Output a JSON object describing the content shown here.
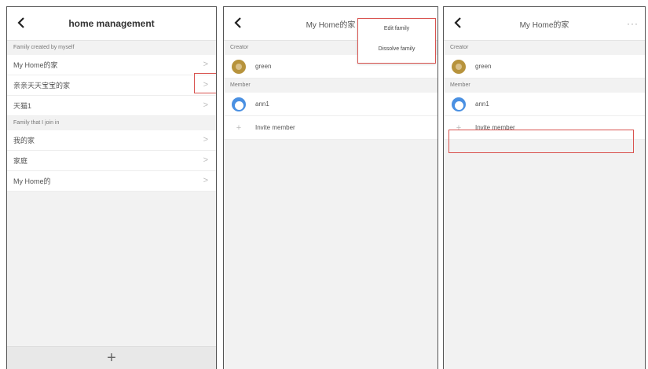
{
  "colors": {
    "highlight": "#d9534f",
    "creator_avatar": "#b7933c",
    "member_avatar": "#4a90e2"
  },
  "panel1": {
    "title": "home management",
    "section_created": "Family created by myself",
    "created_homes": [
      {
        "name": "My Home的家"
      },
      {
        "name": "亲亲天天宝宝的家"
      },
      {
        "name": "天猫1"
      }
    ],
    "section_joined": "Family that I join in",
    "joined_homes": [
      {
        "name": "我的家"
      },
      {
        "name": "家庭"
      },
      {
        "name": "My Home的"
      }
    ],
    "add_icon": "plus-icon"
  },
  "panel2": {
    "title": "My Home的家",
    "creator_label": "Creator",
    "creator_name": "green",
    "member_label": "Member",
    "member_name": "ann1",
    "invite_label": "Invite member",
    "menu": {
      "edit": "Edit family",
      "dissolve": "Dissolve family"
    }
  },
  "panel3": {
    "title": "My Home的家",
    "more": "···",
    "creator_label": "Creator",
    "creator_name": "green",
    "member_label": "Member",
    "member_name": "ann1",
    "invite_label": "Invite member"
  }
}
